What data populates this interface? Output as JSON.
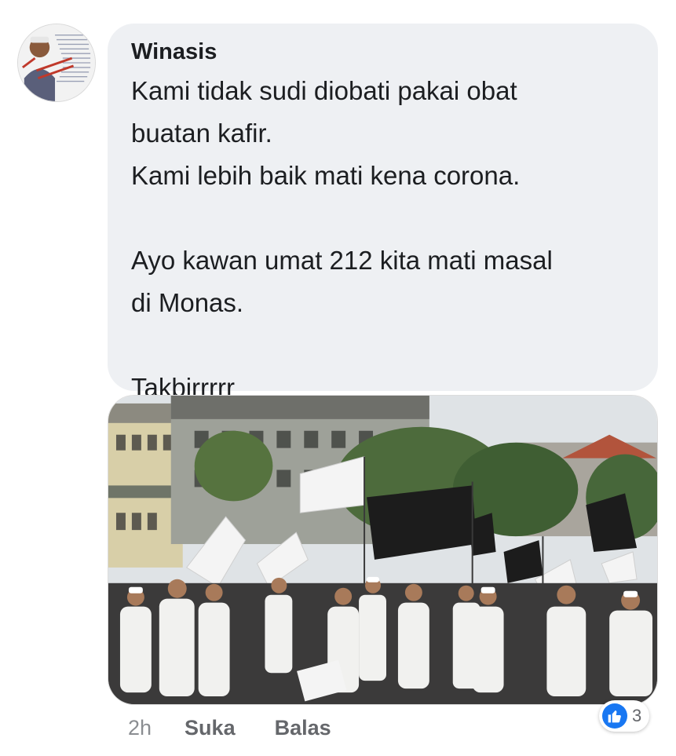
{
  "comment": {
    "author": "Winasis",
    "text": "Kami tidak sudi diobati pakai obat\nbuatan kafir.\nKami lebih baik mati kena corona.\n\nAyo kawan umat 212 kita mati masal\ndi Monas.\n\nTakbirrrrr",
    "avatar_icon": "profile-photo-with-text-overlay",
    "attached_image": "photo of crowd in white clothing holding white and black flags in front of buildings"
  },
  "actions": {
    "time": "2h",
    "like_label": "Suka",
    "reply_label": "Balas"
  },
  "reactions": {
    "icon": "like-thumbs-up-icon",
    "count": "3"
  },
  "colors": {
    "bubble_bg": "#eef0f3",
    "text": "#1c1e21",
    "secondary_text": "#65676b",
    "like_blue": "#1877f2"
  }
}
